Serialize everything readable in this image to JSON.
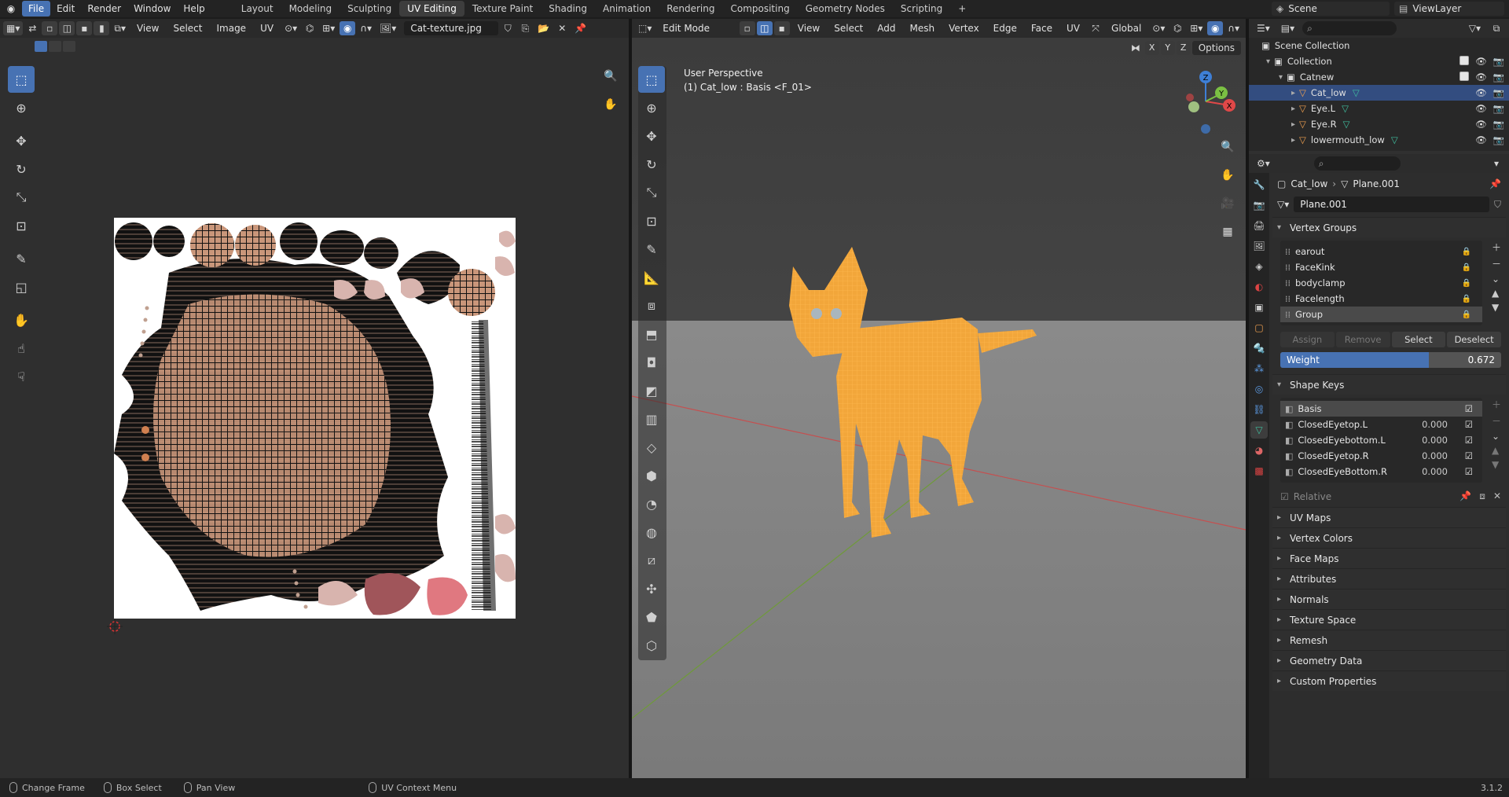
{
  "topbar": {
    "menus": [
      "File",
      "Edit",
      "Render",
      "Window",
      "Help"
    ],
    "workspaces": [
      "Layout",
      "Modeling",
      "Sculpting",
      "UV Editing",
      "Texture Paint",
      "Shading",
      "Animation",
      "Rendering",
      "Compositing",
      "Geometry Nodes",
      "Scripting"
    ],
    "add_tab": "+",
    "scene": "Scene",
    "view_layer": "ViewLayer"
  },
  "uv_editor": {
    "menus": [
      "View",
      "Select",
      "Image",
      "UV"
    ],
    "image_name": "Cat-texture.jpg"
  },
  "viewport": {
    "mode": "Edit Mode",
    "menus": [
      "View",
      "Select",
      "Add",
      "Mesh",
      "Vertex",
      "Edge",
      "Face",
      "UV"
    ],
    "orientation": "Global",
    "options": "Options",
    "axes": [
      "X",
      "Y",
      "Z"
    ],
    "info_line1": "User Perspective",
    "info_line2": "(1) Cat_low : Basis <F_01>",
    "gizmo_axes": {
      "x": "X",
      "y": "Y",
      "z": "Z"
    }
  },
  "outliner": {
    "rows": [
      {
        "label": "Scene Collection"
      },
      {
        "label": "Collection"
      },
      {
        "label": "Catnew"
      },
      {
        "label": "Cat_low"
      },
      {
        "label": "Eye.L"
      },
      {
        "label": "Eye.R"
      },
      {
        "label": "lowermouth_low"
      }
    ]
  },
  "properties": {
    "breadcrumb_object": "Cat_low",
    "breadcrumb_sep": "›",
    "breadcrumb_data": "Plane.001",
    "data_name": "Plane.001",
    "vertex_groups_title": "Vertex Groups",
    "vertex_groups": [
      "earout",
      "FaceKink",
      "bodyclamp",
      "Facelength",
      "Group"
    ],
    "buttons": {
      "assign": "Assign",
      "remove": "Remove",
      "select": "Select",
      "deselect": "Deselect"
    },
    "weight_label": "Weight",
    "weight_value": "0.672",
    "weight_fraction": 0.672,
    "shape_keys_title": "Shape Keys",
    "shape_keys": [
      {
        "name": "Basis",
        "value": ""
      },
      {
        "name": "ClosedEyetop.L",
        "value": "0.000"
      },
      {
        "name": "ClosedEyebottom.L",
        "value": "0.000"
      },
      {
        "name": "ClosedEyetop.R",
        "value": "0.000"
      },
      {
        "name": "ClosedEyeBottom.R",
        "value": "0.000"
      }
    ],
    "relative_label": "Relative",
    "collapsed_panels": [
      "UV Maps",
      "Vertex Colors",
      "Face Maps",
      "Attributes",
      "Normals",
      "Texture Space",
      "Remesh",
      "Geometry Data",
      "Custom Properties"
    ]
  },
  "statusbar": {
    "items": [
      "Change Frame",
      "Box Select",
      "Pan View",
      "UV Context Menu"
    ],
    "version": "3.1.2"
  },
  "colors": {
    "accent": "#4772b3",
    "selection_orange": "#ff9c1e",
    "x_axis": "#e04848",
    "y_axis": "#7bc043",
    "z_axis": "#3e7fd6"
  }
}
